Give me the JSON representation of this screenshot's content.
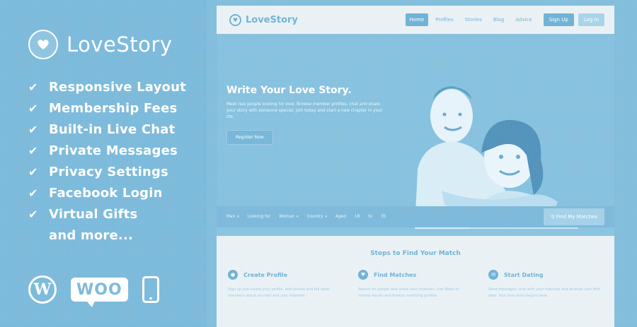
{
  "promo": {
    "brand": "LoveStory",
    "features": [
      "Responsive Layout",
      "Membership Fees",
      "Built-in Live Chat",
      "Private Messages",
      "Privacy Settings",
      "Facebook Login",
      "Virtual Gifts"
    ],
    "more": "and more...",
    "platforms": {
      "wordpress": "W",
      "woo": "WOO"
    }
  },
  "site": {
    "brand": "LoveStory",
    "nav": [
      "Home",
      "Profiles",
      "Stories",
      "Blog",
      "Advice"
    ],
    "active_nav": "Home",
    "signup_label": "Sign Up",
    "login_label": "Log In",
    "hero": {
      "title": "Write Your Love Story.",
      "description": "Meet real people looking for love. Browse member profiles, chat and share your story with someone special. Join today and start a new chapter in your life.",
      "cta": "Register Now"
    },
    "search": {
      "fields": [
        "Man",
        "Looking for",
        "Woman",
        "Country",
        "Aged",
        "18",
        "to",
        "35"
      ],
      "button": "Find My Matches"
    },
    "steps": {
      "title": "Steps to Find Your Match",
      "items": [
        {
          "title": "Create Profile",
          "text": "Sign up and create your profile. Add photos and tell other members about yourself and your interests."
        },
        {
          "title": "Find Matches",
          "text": "Search for people who share your interests. Use filters to narrow results and browse matching profiles."
        },
        {
          "title": "Start Dating",
          "text": "Send messages, chat with your matches and arrange your first date. Your love story begins here."
        }
      ]
    }
  },
  "colors": {
    "background": "#82bedc",
    "accent": "#6fb2d6",
    "panel_light": "#eaf1f5"
  }
}
